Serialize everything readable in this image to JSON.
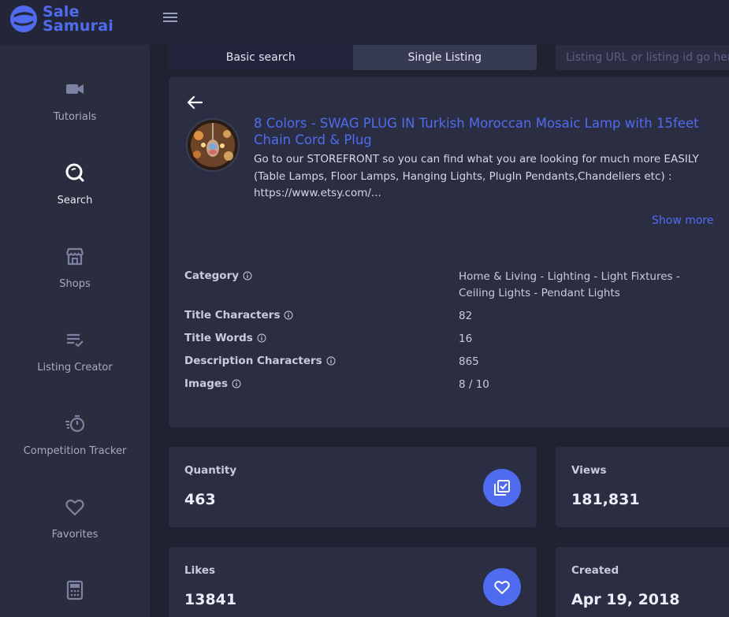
{
  "app": {
    "logo_line1": "Sale",
    "logo_line2": "Samurai"
  },
  "sidebar": {
    "items": [
      {
        "label": "Tutorials",
        "icon": "video-camera-icon"
      },
      {
        "label": "Search",
        "icon": "search-icon",
        "active": true
      },
      {
        "label": "Shops",
        "icon": "storefront-icon"
      },
      {
        "label": "Listing Creator",
        "icon": "checklist-icon"
      },
      {
        "label": "Competition Tracker",
        "icon": "stopwatch-icon"
      },
      {
        "label": "Favorites",
        "icon": "heart-icon"
      },
      {
        "label": "",
        "icon": "calculator-icon"
      }
    ]
  },
  "search": {
    "tab_basic": "Basic search",
    "tab_single": "Single Listing",
    "url_placeholder": "Listing URL or listing id go here"
  },
  "listing": {
    "title": "8 Colors - SWAG PLUG IN Turkish Moroccan Mosaic Lamp with 15feet Chain Cord & Plug",
    "description": "Go to our STOREFRONT so you can find what you are looking for much more EASILY (Table Lamps, Floor Lamps, Hanging Lights, PlugIn Pendants,Chandeliers etc) : https://www.etsy.com/...",
    "show_more": "Show more",
    "meta": [
      {
        "label": "Category",
        "value": "Home & Living - Lighting - Light Fixtures - Ceiling Lights - Pendant Lights"
      },
      {
        "label": "Title Characters",
        "value": "82"
      },
      {
        "label": "Title Words",
        "value": "16"
      },
      {
        "label": "Description Characters",
        "value": "865"
      },
      {
        "label": "Images",
        "value": "8 / 10"
      }
    ]
  },
  "stats": {
    "quantity": {
      "label": "Quantity",
      "value": "463",
      "icon": "checked-stack-icon"
    },
    "views": {
      "label": "Views",
      "value": "181,831"
    },
    "likes": {
      "label": "Likes",
      "value": "13841",
      "icon": "heart-icon"
    },
    "created": {
      "label": "Created",
      "value": "Apr 19, 2018"
    }
  },
  "colors": {
    "accent": "#4f6cf0",
    "background": "#1f2230",
    "sidebar": "#2a2d3d",
    "panel": "#2b2e42"
  }
}
